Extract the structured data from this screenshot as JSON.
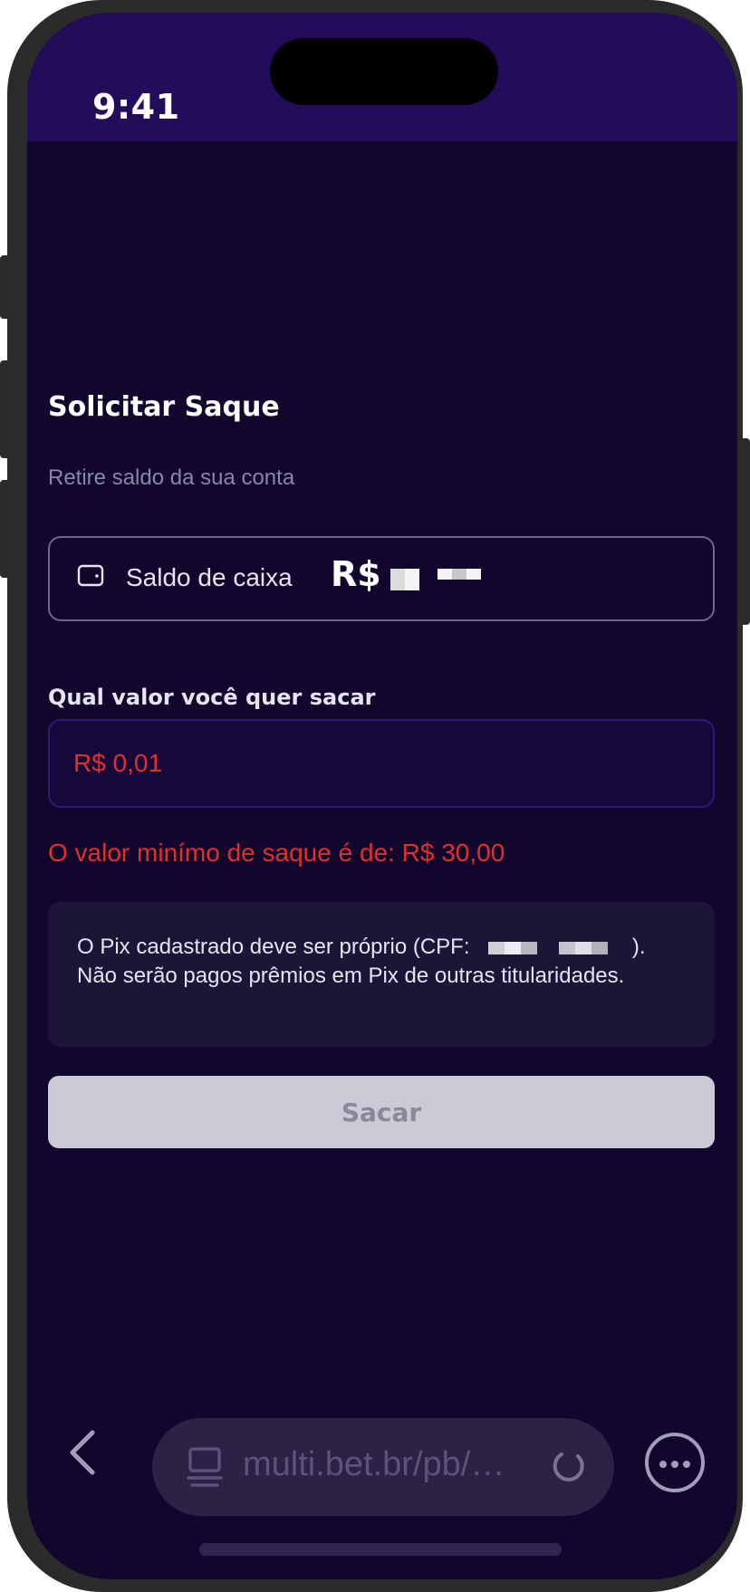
{
  "status_bar": {
    "time": "9:41"
  },
  "withdraw": {
    "title": "Solicitar Saque",
    "subtitle": "Retire saldo da sua conta",
    "balance_label": "Saldo de caixa",
    "balance_currency": "R$",
    "amount_label": "Qual valor você quer sacar",
    "amount_value": "R$ 0,01",
    "error_message": "O valor minímo de saque é de: R$ 30,00",
    "info_prefix": "O Pix cadastrado deve ser próprio (CPF:",
    "info_suffix": ").",
    "info_rest": "Não serão pagos prêmios em Pix de outras titularidades.",
    "submit_label": "Sacar"
  },
  "browser": {
    "url": "multi.bet.br/pb/…"
  },
  "colors": {
    "background": "#11062b",
    "status_bar": "#230c59",
    "error": "#e0302f",
    "button_disabled": "#cccad6"
  },
  "icons": [
    "wallet-icon",
    "back-chevron-icon",
    "tabs-icon",
    "reload-icon",
    "more-icon"
  ]
}
